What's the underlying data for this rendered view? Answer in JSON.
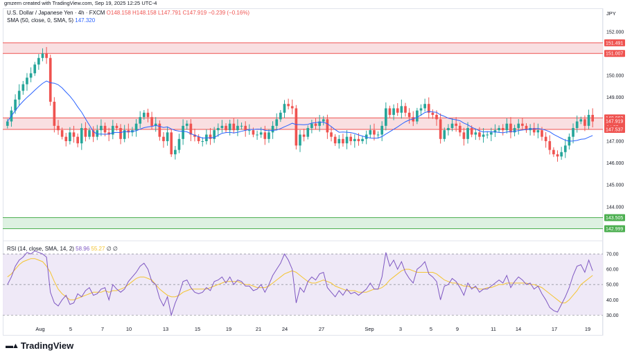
{
  "credit": "gmzern created with TradingView.com, Sep 19, 2025 12:25 UTC-4",
  "legend": {
    "symbol": "U.S. Dollar / Japanese Yen · 4h · FXCM",
    "o": "O148.158",
    "h": "H148.158",
    "l": "L147.791",
    "c": "C147.919",
    "chg": "−0.239 (−0.16%)",
    "sma_label": "SMA (50, close, 0, SMA, 5)",
    "sma_value": "147.320"
  },
  "rsi_legend": {
    "label": "RSI (14, close, SMA, 14, 2)",
    "rsi_value": "58.96",
    "sma_value": "55.27",
    "extra": "∅ ∅"
  },
  "brand": "TradingView",
  "colors": {
    "up": "#26a69a",
    "down": "#ef5350",
    "sma": "#2962ff",
    "rsi": "#7e57c2",
    "rsi_ma": "#f4c430",
    "resistance_zone": "#f8d7da",
    "support_zone": "#d4edda"
  },
  "chart_data": [
    {
      "type": "candlestick",
      "currency": "JPY",
      "y_ticks": [
        144.0,
        145.0,
        146.0,
        147.0,
        148.0,
        149.0,
        150.0,
        151.0,
        152.0
      ],
      "ylim": [
        142.7,
        152.5
      ],
      "x_tick_labels": [
        "Aug",
        "5",
        "7",
        "10",
        "13",
        "15",
        "19",
        "21",
        "24",
        "27",
        "Sep",
        "3",
        "5",
        "9",
        "11",
        "14",
        "17",
        "19"
      ],
      "price_labels": {
        "zone_high_top": "151.491",
        "zone_high_bottom": "151.007",
        "current": "147.919",
        "countdown": "34:55",
        "zone_mid_top": "148.063",
        "zone_mid_bottom": "147.537",
        "support_top": "143.505",
        "support_bottom": "142.999"
      },
      "zones": [
        {
          "from": 151.007,
          "to": 151.491,
          "kind": "resistance"
        },
        {
          "from": 147.537,
          "to": 148.063,
          "kind": "resistance"
        },
        {
          "from": 142.999,
          "to": 143.505,
          "kind": "support"
        }
      ],
      "close_series": [
        147.9,
        148.4,
        148.9,
        149.3,
        149.6,
        149.9,
        150.1,
        150.5,
        150.8,
        151.0,
        150.8,
        148.8,
        147.7,
        147.5,
        147.2,
        147.0,
        147.4,
        147.2,
        146.9,
        147.6,
        147.2,
        147.5,
        147.2,
        147.5,
        147.7,
        147.4,
        147.3,
        147.7,
        147.6,
        147.1,
        147.5,
        147.4,
        147.5,
        147.8,
        148.1,
        148.3,
        148.1,
        147.7,
        147.8,
        147.2,
        147.0,
        147.4,
        146.4,
        146.6,
        147.1,
        147.7,
        147.8,
        147.3,
        147.2,
        147.0,
        147.0,
        147.3,
        147.1,
        147.5,
        147.6,
        147.7,
        147.5,
        147.8,
        147.5,
        147.7,
        147.7,
        147.5,
        147.5,
        147.3,
        147.3,
        147.4,
        147.1,
        147.4,
        147.7,
        148.0,
        148.3,
        148.7,
        148.6,
        148.5,
        146.8,
        147.3,
        147.2,
        147.6,
        147.8,
        147.7,
        147.9,
        148.0,
        147.4,
        147.2,
        146.9,
        147.1,
        146.9,
        147.2,
        147.0,
        147.1,
        147.0,
        147.1,
        147.3,
        147.5,
        147.3,
        147.3,
        147.7,
        148.5,
        148.2,
        148.5,
        148.3,
        148.6,
        148.3,
        148.1,
        147.9,
        148.4,
        148.5,
        148.7,
        148.3,
        148.2,
        148.0,
        147.1,
        147.5,
        147.6,
        147.8,
        147.7,
        147.4,
        147.1,
        147.6,
        147.3,
        147.4,
        147.2,
        147.3,
        147.3,
        147.4,
        147.5,
        147.6,
        147.5,
        147.8,
        147.4,
        147.6,
        147.8,
        147.7,
        147.5,
        147.6,
        147.4,
        147.5,
        147.2,
        147.0,
        146.6,
        146.4,
        146.3,
        146.5,
        146.8,
        147.2,
        147.6,
        147.9,
        148.0,
        147.7,
        148.2,
        147.9
      ]
    },
    {
      "type": "line",
      "name": "RSI",
      "y_ticks": [
        30.0,
        40.0,
        50.0,
        60.0,
        70.0
      ],
      "ylim": [
        27,
        75
      ],
      "band": [
        30,
        70
      ],
      "rsi_series": [
        50,
        55,
        62,
        66,
        68,
        71,
        70,
        72,
        71,
        70,
        68,
        45,
        38,
        36,
        40,
        43,
        37,
        38,
        44,
        42,
        46,
        48,
        43,
        44,
        47,
        48,
        40,
        50,
        47,
        45,
        47,
        52,
        55,
        58,
        62,
        64,
        60,
        52,
        50,
        41,
        36,
        42,
        30,
        38,
        44,
        52,
        53,
        48,
        45,
        44,
        45,
        48,
        46,
        52,
        53,
        55,
        51,
        55,
        50,
        53,
        52,
        49,
        49,
        46,
        47,
        50,
        45,
        50,
        56,
        60,
        64,
        70,
        66,
        60,
        38,
        48,
        45,
        52,
        55,
        53,
        57,
        58,
        48,
        45,
        42,
        46,
        43,
        47,
        44,
        45,
        43,
        45,
        47,
        51,
        47,
        47,
        55,
        71,
        62,
        66,
        60,
        65,
        58,
        54,
        51,
        60,
        62,
        65,
        57,
        55,
        52,
        40,
        49,
        50,
        54,
        52,
        48,
        43,
        51,
        47,
        49,
        45,
        47,
        47,
        49,
        51,
        53,
        51,
        56,
        48,
        52,
        55,
        53,
        50,
        51,
        47,
        49,
        44,
        40,
        35,
        33,
        32,
        37,
        42,
        48,
        56,
        62,
        63,
        58,
        66,
        59
      ],
      "rsi_ma_series": [
        55,
        57,
        60,
        63,
        65,
        66,
        67,
        67,
        66,
        65,
        62,
        58,
        52,
        47,
        44,
        42,
        40,
        40,
        41,
        42,
        43,
        44,
        45,
        45,
        45,
        46,
        45,
        46,
        46,
        47,
        48,
        50,
        52,
        54,
        55,
        55,
        54,
        53,
        50,
        47,
        45,
        43,
        42,
        42,
        43,
        45,
        46,
        47,
        47,
        47,
        47,
        47,
        48,
        49,
        50,
        51,
        52,
        52,
        52,
        52,
        51,
        50,
        50,
        49,
        48,
        48,
        48,
        49,
        51,
        53,
        55,
        57,
        58,
        59,
        58,
        56,
        54,
        52,
        51,
        51,
        52,
        53,
        52,
        51,
        49,
        48,
        47,
        46,
        46,
        46,
        45,
        45,
        45,
        46,
        47,
        47,
        48,
        50,
        53,
        55,
        57,
        59,
        60,
        60,
        59,
        58,
        58,
        58,
        58,
        58,
        57,
        55,
        53,
        52,
        51,
        51,
        50,
        49,
        49,
        48,
        48,
        47,
        47,
        48,
        48,
        49,
        50,
        50,
        51,
        51,
        51,
        51,
        51,
        51,
        50,
        50,
        49,
        48,
        46,
        44,
        42,
        40,
        38,
        38,
        40,
        43,
        46,
        50,
        52,
        54,
        56
      ]
    }
  ]
}
